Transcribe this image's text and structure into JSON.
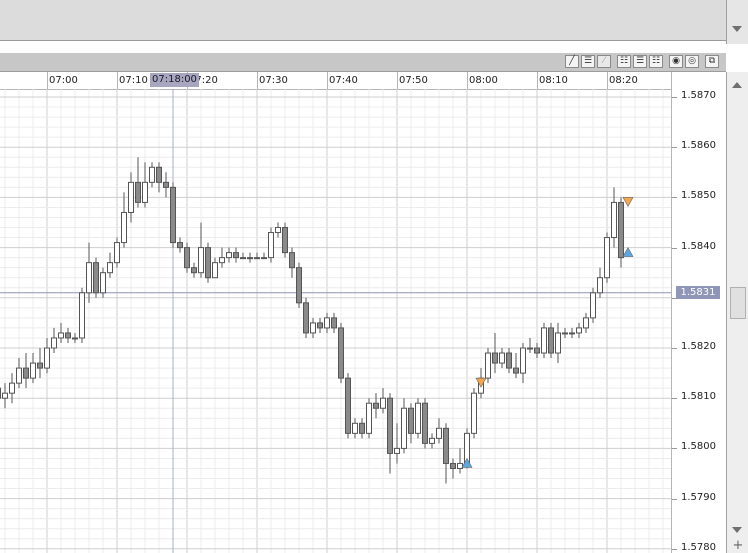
{
  "chart_data": {
    "type": "candlestick",
    "time_ticks": [
      "07:00",
      "07:10",
      "07:20",
      "07:30",
      "07:40",
      "07:50",
      "08:00",
      "08:10",
      "08:20"
    ],
    "price_ticks": [
      "1.5870",
      "1.5860",
      "1.5850",
      "1.5840",
      "1.5830",
      "1.5820",
      "1.5810",
      "1.5800",
      "1.5790",
      "1.5780"
    ],
    "ylim": [
      1.578,
      1.5872
    ],
    "crosshair": {
      "time": "07:18:00",
      "price": "1.5831"
    },
    "bar_minutes": 1,
    "first_bar_time": "06:52",
    "candles": [
      [
        1.5815,
        1.5812,
        1.5818,
        1.581
      ],
      [
        1.5812,
        1.581,
        1.5814,
        1.5809
      ],
      [
        1.581,
        1.5811,
        1.5813,
        1.5808
      ],
      [
        1.5811,
        1.5813,
        1.5815,
        1.5809
      ],
      [
        1.5813,
        1.5816,
        1.5818,
        1.5812
      ],
      [
        1.5816,
        1.5814,
        1.5819,
        1.5812
      ],
      [
        1.5814,
        1.5817,
        1.5819,
        1.5813
      ],
      [
        1.5817,
        1.5816,
        1.582,
        1.5814
      ],
      [
        1.5816,
        1.582,
        1.5822,
        1.5815
      ],
      [
        1.582,
        1.5822,
        1.5824,
        1.5819
      ],
      [
        1.5822,
        1.5823,
        1.5825,
        1.5821
      ],
      [
        1.5823,
        1.5822,
        1.5824,
        1.5821
      ],
      [
        1.5822,
        1.5822,
        1.5823,
        1.5821
      ],
      [
        1.5822,
        1.5831,
        1.5832,
        1.5821
      ],
      [
        1.5831,
        1.5837,
        1.5841,
        1.5829
      ],
      [
        1.5837,
        1.5831,
        1.5838,
        1.583
      ],
      [
        1.5831,
        1.5835,
        1.5836,
        1.583
      ],
      [
        1.5835,
        1.5837,
        1.5839,
        1.5834
      ],
      [
        1.5837,
        1.5841,
        1.5842,
        1.5836
      ],
      [
        1.5841,
        1.5847,
        1.5851,
        1.584
      ],
      [
        1.5847,
        1.5853,
        1.5855,
        1.5845
      ],
      [
        1.5853,
        1.5849,
        1.5858,
        1.5848
      ],
      [
        1.5849,
        1.5853,
        1.5857,
        1.5848
      ],
      [
        1.5853,
        1.5856,
        1.5857,
        1.5852
      ],
      [
        1.5856,
        1.5853,
        1.5857,
        1.5851
      ],
      [
        1.5853,
        1.5852,
        1.5855,
        1.585
      ],
      [
        1.5852,
        1.5841,
        1.5853,
        1.584
      ],
      [
        1.5841,
        1.584,
        1.5842,
        1.5839
      ],
      [
        1.584,
        1.5836,
        1.5841,
        1.5835
      ],
      [
        1.5836,
        1.5835,
        1.5837,
        1.5834
      ],
      [
        1.5835,
        1.584,
        1.5845,
        1.5834
      ],
      [
        1.584,
        1.5834,
        1.5841,
        1.5833
      ],
      [
        1.5834,
        1.5837,
        1.5838,
        1.5836
      ],
      [
        1.5837,
        1.5838,
        1.584,
        1.5836
      ],
      [
        1.5838,
        1.5839,
        1.584,
        1.5837
      ],
      [
        1.5839,
        1.5838,
        1.584,
        1.5837
      ],
      [
        1.5838,
        1.5838,
        1.5839,
        1.5838
      ],
      [
        1.5838,
        1.5838,
        1.5839,
        1.5837
      ],
      [
        1.5838,
        1.5838,
        1.5839,
        1.5838
      ],
      [
        1.5838,
        1.5838,
        1.5839,
        1.5838
      ],
      [
        1.5838,
        1.5843,
        1.5844,
        1.5837
      ],
      [
        1.5843,
        1.5844,
        1.5845,
        1.5842
      ],
      [
        1.5844,
        1.5839,
        1.5845,
        1.5838
      ],
      [
        1.5839,
        1.5836,
        1.584,
        1.5834
      ],
      [
        1.5836,
        1.5829,
        1.5837,
        1.5828
      ],
      [
        1.5829,
        1.5823,
        1.583,
        1.5822
      ],
      [
        1.5823,
        1.5825,
        1.5826,
        1.5822
      ],
      [
        1.5825,
        1.5824,
        1.5826,
        1.5823
      ],
      [
        1.5824,
        1.5826,
        1.5827,
        1.5823
      ],
      [
        1.5826,
        1.5824,
        1.5827,
        1.5823
      ],
      [
        1.5824,
        1.5814,
        1.5825,
        1.5813
      ],
      [
        1.5814,
        1.5803,
        1.5815,
        1.5802
      ],
      [
        1.5803,
        1.5805,
        1.5806,
        1.5802
      ],
      [
        1.5805,
        1.5803,
        1.5806,
        1.5802
      ],
      [
        1.5803,
        1.5809,
        1.581,
        1.5802
      ],
      [
        1.5809,
        1.5808,
        1.5811,
        1.5806
      ],
      [
        1.5808,
        1.581,
        1.5812,
        1.5807
      ],
      [
        1.581,
        1.5799,
        1.5811,
        1.5795
      ],
      [
        1.5799,
        1.58,
        1.5805,
        1.5797
      ],
      [
        1.58,
        1.5808,
        1.581,
        1.5799
      ],
      [
        1.5808,
        1.5803,
        1.5809,
        1.5801
      ],
      [
        1.5803,
        1.5809,
        1.581,
        1.5802
      ],
      [
        1.5809,
        1.5801,
        1.581,
        1.58
      ],
      [
        1.5801,
        1.5802,
        1.5803,
        1.58
      ],
      [
        1.5802,
        1.5804,
        1.5806,
        1.5801
      ],
      [
        1.5804,
        1.5797,
        1.5805,
        1.5793
      ],
      [
        1.5797,
        1.5796,
        1.5798,
        1.5794
      ],
      [
        1.5796,
        1.5797,
        1.58,
        1.5795
      ],
      [
        1.5797,
        1.5803,
        1.5804,
        1.5796
      ],
      [
        1.5803,
        1.5811,
        1.5812,
        1.5802
      ],
      [
        1.5811,
        1.5814,
        1.5816,
        1.581
      ],
      [
        1.5814,
        1.5819,
        1.582,
        1.5813
      ],
      [
        1.5819,
        1.5817,
        1.5823,
        1.5815
      ],
      [
        1.5817,
        1.5819,
        1.582,
        1.5816
      ],
      [
        1.5819,
        1.5816,
        1.582,
        1.5815
      ],
      [
        1.5816,
        1.5815,
        1.5819,
        1.5814
      ],
      [
        1.5815,
        1.582,
        1.5821,
        1.5813
      ],
      [
        1.582,
        1.582,
        1.5822,
        1.5819
      ],
      [
        1.582,
        1.5819,
        1.5821,
        1.5818
      ],
      [
        1.5819,
        1.5824,
        1.5825,
        1.5818
      ],
      [
        1.5824,
        1.5819,
        1.5825,
        1.5818
      ],
      [
        1.5819,
        1.5823,
        1.5825,
        1.5817
      ],
      [
        1.5823,
        1.5823,
        1.5824,
        1.5822
      ],
      [
        1.5823,
        1.5823,
        1.5824,
        1.5822
      ],
      [
        1.5823,
        1.5824,
        1.5825,
        1.5822
      ],
      [
        1.5824,
        1.5826,
        1.5827,
        1.5823
      ],
      [
        1.5826,
        1.5831,
        1.5832,
        1.5825
      ],
      [
        1.5831,
        1.5834,
        1.5836,
        1.583
      ],
      [
        1.5834,
        1.5842,
        1.5843,
        1.5833
      ],
      [
        1.5842,
        1.5849,
        1.5852,
        1.584
      ],
      [
        1.5849,
        1.5838,
        1.585,
        1.5836
      ]
    ],
    "markers": [
      {
        "time": "08:02",
        "price": 1.5813,
        "kind": "sell",
        "color": "#f5a54a"
      },
      {
        "time": "08:00",
        "price": 1.5797,
        "kind": "buy",
        "color": "#5aa8e0"
      },
      {
        "time": "08:23",
        "price": 1.5849,
        "kind": "sell",
        "color": "#f5a54a"
      },
      {
        "time": "08:23",
        "price": 1.5839,
        "kind": "buy",
        "color": "#5aa8e0"
      }
    ]
  }
}
